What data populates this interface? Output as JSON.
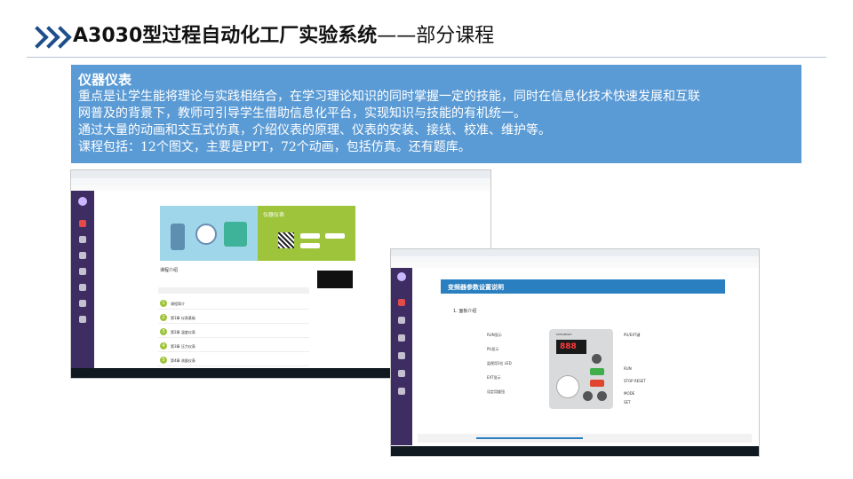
{
  "header": {
    "title_bold": "A3030型过程自动化工厂实验系统",
    "title_rest": "——部分课程"
  },
  "info": {
    "heading": "仪器仪表",
    "lines": [
      "重点是让学生能将理论与实践相结合，在学习理论知识的同时掌握一定的技能，同时在信息化技术快速发展和互联",
      "网普及的背景下，教师可引导学生借助信息化平台，实现知识与技能的有机统一。",
      "通过大量的动画和交互式仿真，介绍仪表的原理、仪表的安装、接线、校准、维护等。",
      "课程包括：12个图文，主要是PPT，72个动画，包括仿真。还有题库。"
    ]
  },
  "screenshot1": {
    "course_title": "仪器仪表",
    "tab_label": "课程介绍",
    "rows": [
      "课程简介",
      "第1章 仪表基础",
      "第2章 温度仪表",
      "第3章 压力仪表",
      "第4章 流量仪表"
    ]
  },
  "screenshot2": {
    "page_title": "变频器参数设置说明",
    "section": "1. 面板介绍",
    "display_value": "888",
    "labels_left": [
      "RUN显示",
      "PU显示",
      "监视用3位 LED",
      "EXT显示",
      "设定用旋钮"
    ],
    "labels_right": [
      "PU/EXT键",
      "RUN",
      "STOP RESET",
      "MODE",
      "SET"
    ],
    "brand": "MITSUBISHI"
  },
  "colors": {
    "accent": "#1f4e8c",
    "info_bg": "#5b9bd5",
    "sidebar": "#3e2d63",
    "green": "#9dc43a"
  }
}
